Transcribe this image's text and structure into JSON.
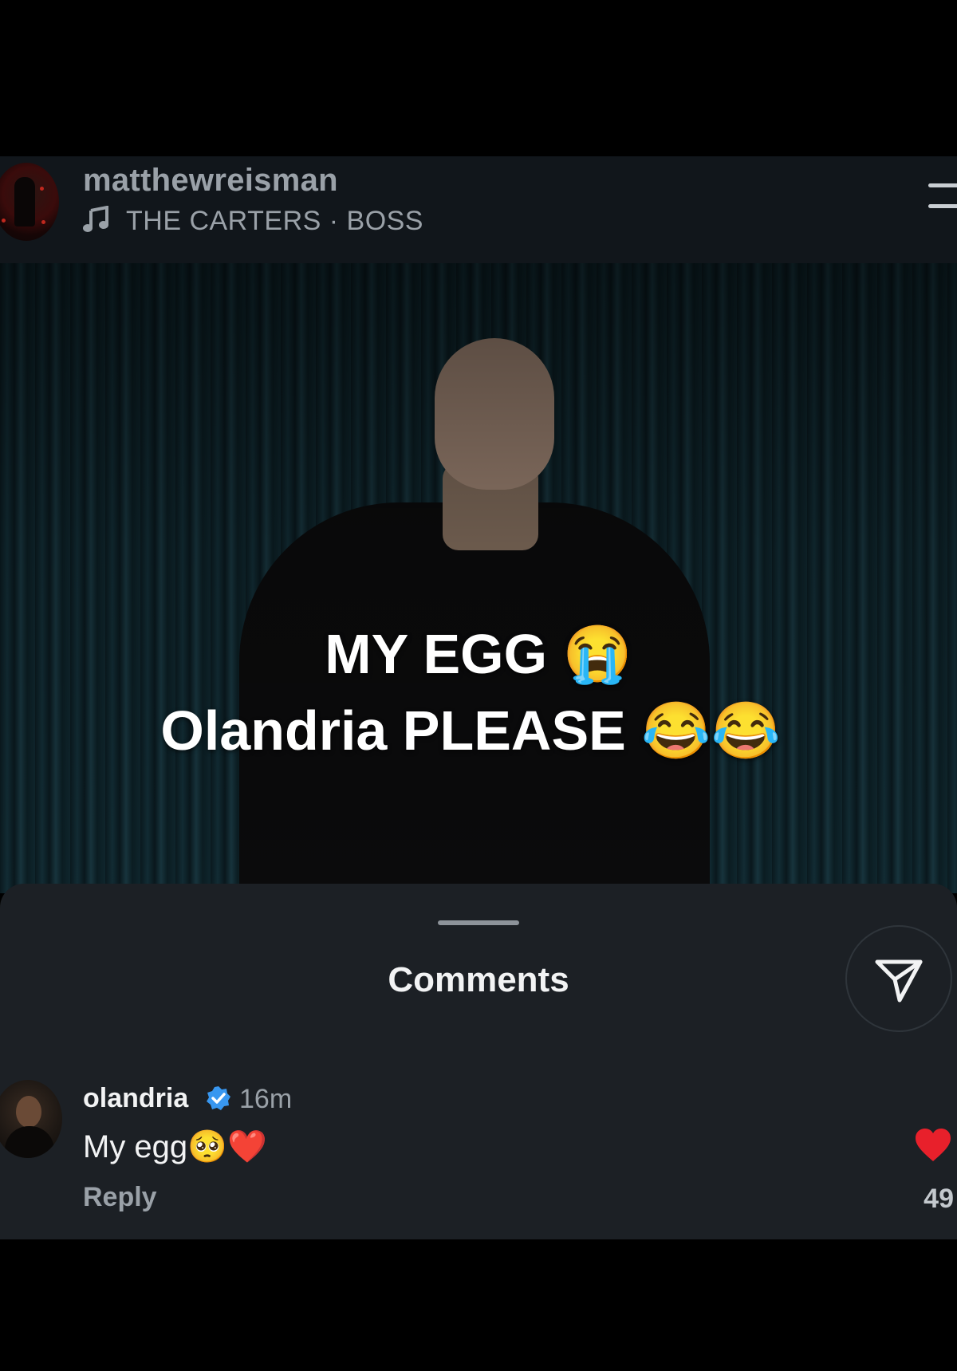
{
  "header": {
    "username": "matthewreisman",
    "song": "THE CARTERS · BOSS"
  },
  "video": {
    "caption_line1": "MY EGG 😭",
    "caption_line2": "Olandria PLEASE  😂😂"
  },
  "comments_sheet": {
    "title": "Comments",
    "comment": {
      "username": "olandria",
      "verified": true,
      "time": "16m",
      "text": "My egg🥺❤️",
      "reply_label": "Reply",
      "like_count": "49"
    }
  },
  "colors": {
    "header_bg": "#11161b",
    "sheet_bg": "#1c2025",
    "like_heart": "#e8202b",
    "verified_badge": "#3897f0"
  }
}
